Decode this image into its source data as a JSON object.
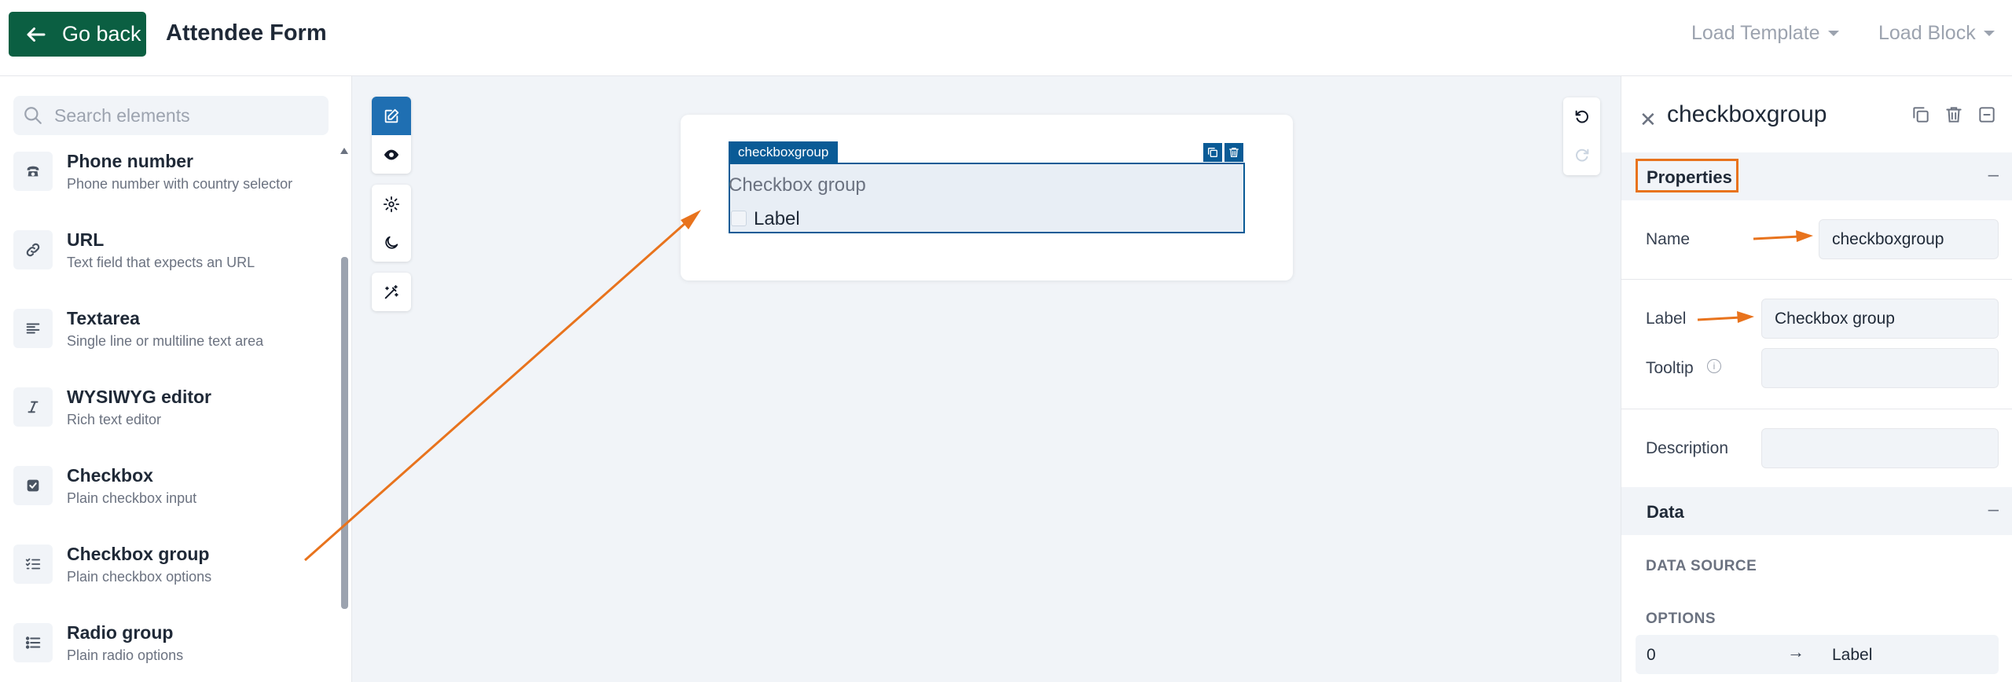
{
  "header": {
    "back_label": "Go back",
    "title": "Attendee Form",
    "menus": [
      "Load Template",
      "Load Block"
    ],
    "accent_color": "#0b5f42"
  },
  "sidebar": {
    "search_placeholder": "Search elements",
    "items": [
      {
        "name": "Phone number",
        "desc": "Phone number with country selector",
        "icon": "phone-icon"
      },
      {
        "name": "URL",
        "desc": "Text field that expects an URL",
        "icon": "link-icon"
      },
      {
        "name": "Textarea",
        "desc": "Single line or multiline text area",
        "icon": "align-left-icon"
      },
      {
        "name": "WYSIWYG editor",
        "desc": "Rich text editor",
        "icon": "italic-icon"
      },
      {
        "name": "Checkbox",
        "desc": "Plain checkbox input",
        "icon": "checkbox-icon"
      },
      {
        "name": "Checkbox group",
        "desc": "Plain checkbox options",
        "icon": "checklist-icon"
      },
      {
        "name": "Radio group",
        "desc": "Plain radio options",
        "icon": "list-icon"
      }
    ]
  },
  "toolbar": {
    "tools": [
      "edit-icon",
      "eye-icon",
      "gear-icon",
      "moon-icon",
      "magic-wand-icon"
    ]
  },
  "canvas": {
    "selected_tag": "checkboxgroup",
    "group_label": "Checkbox group",
    "option_label": "Label",
    "selection_color": "#0a5b96"
  },
  "panel": {
    "title": "checkboxgroup",
    "properties": {
      "heading": "Properties",
      "name_label": "Name",
      "name_value": "checkboxgroup",
      "label_label": "Label",
      "label_value": "Checkbox group",
      "tooltip_label": "Tooltip",
      "tooltip_value": "",
      "description_label": "Description",
      "description_value": ""
    },
    "data": {
      "heading": "Data",
      "data_source": "DATA SOURCE",
      "options_heading": "OPTIONS",
      "options": [
        {
          "value": "0",
          "label": "Label"
        }
      ]
    }
  },
  "annotation_color": "#e8731d"
}
